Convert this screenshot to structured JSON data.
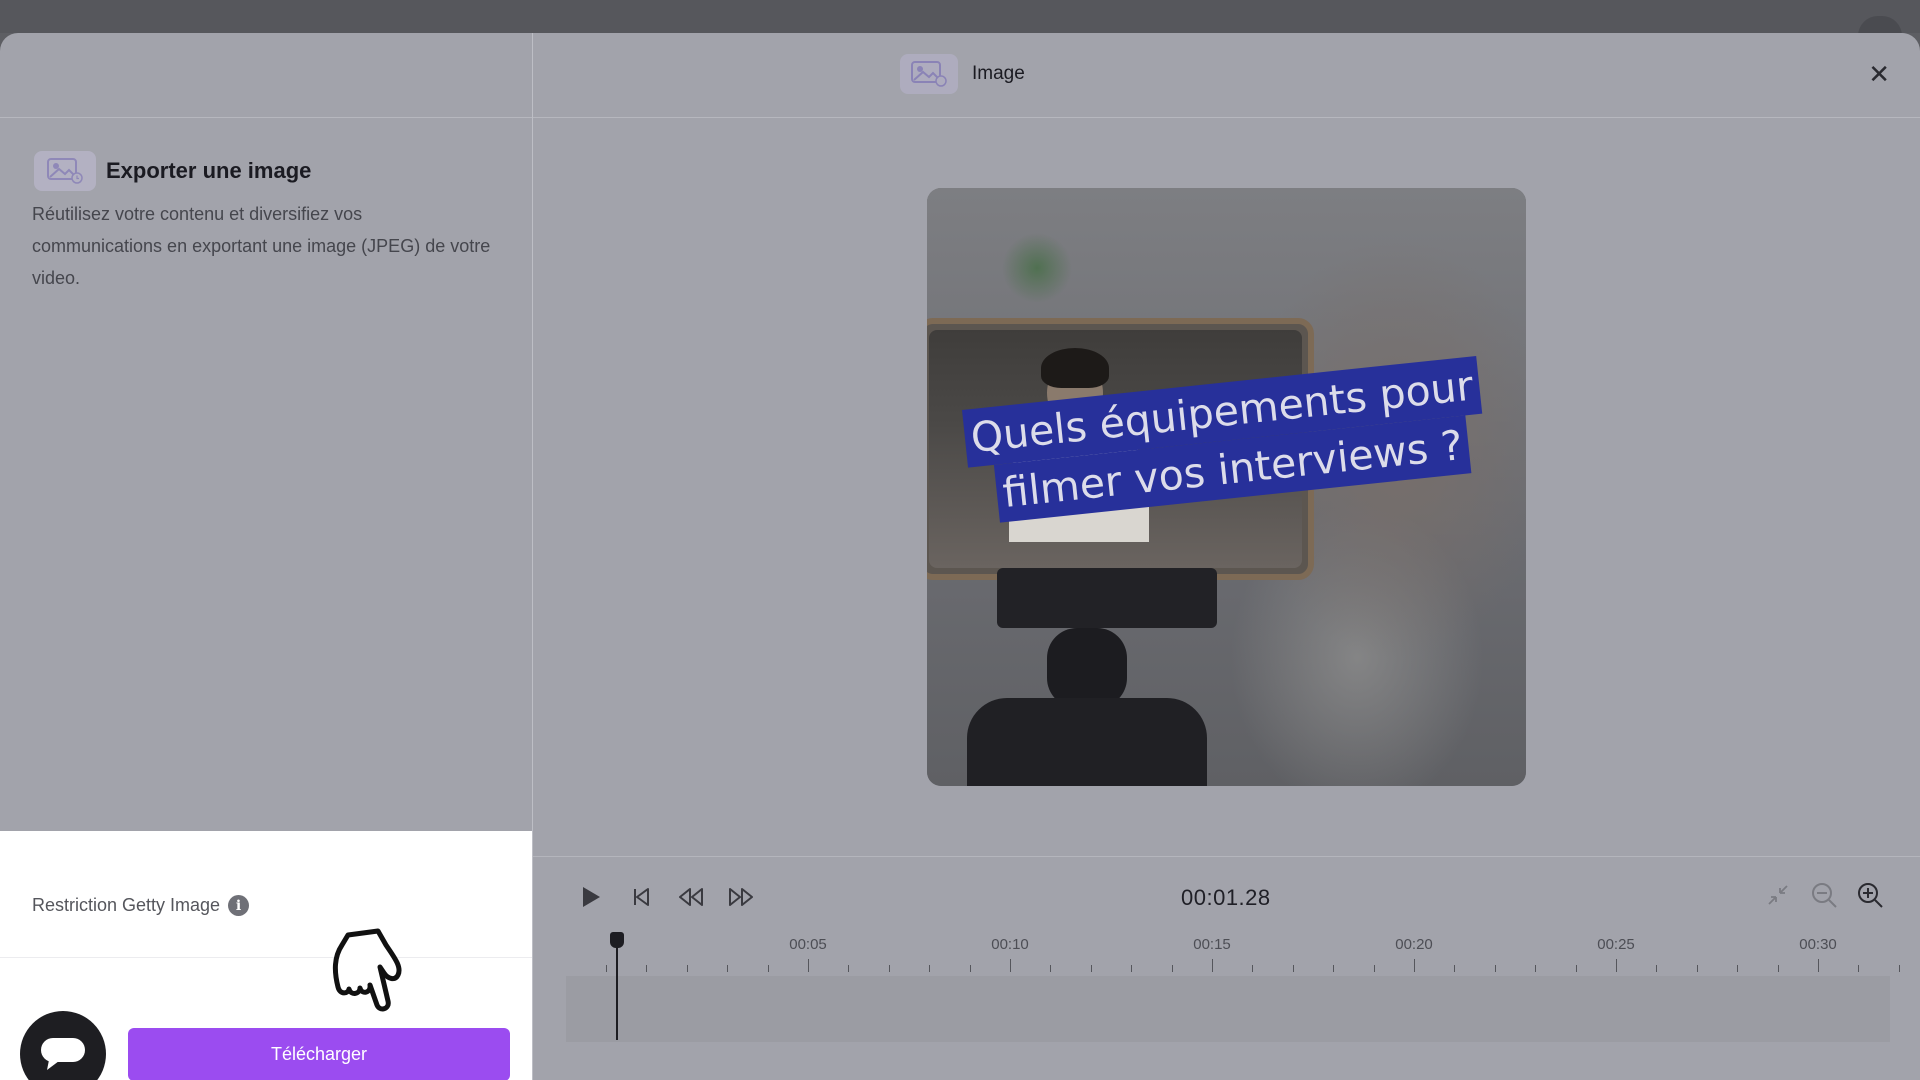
{
  "modal": {
    "left": {
      "export_title": "Exporter une image",
      "export_description": "Réutilisez votre contenu et diversifiez vos communications en exportant une image (JPEG) de votre video.",
      "restriction_label": "Restriction Getty Image",
      "info_icon": "i",
      "download_label": "Télécharger",
      "chat_icon": "chat-bubble-icon",
      "cursor_icon": "pointing-hand-cursor-icon"
    },
    "header": {
      "title": "Image",
      "image_icon": "image-icon",
      "close_label": "✕"
    },
    "preview": {
      "caption_line1": "Quels équipements pour",
      "caption_line2": "filmer vos interviews ?",
      "caption_bg": "#27309a"
    },
    "timeline": {
      "timecode": "00:01.28",
      "ruler": [
        "00:05",
        "00:10",
        "00:15",
        "00:20",
        "00:25",
        "00:30"
      ],
      "playhead_time": "00:01.28"
    }
  },
  "colors": {
    "accent": "#9b4cf0",
    "overlay": "#a2a3ab",
    "caption_box": "#27309a"
  }
}
